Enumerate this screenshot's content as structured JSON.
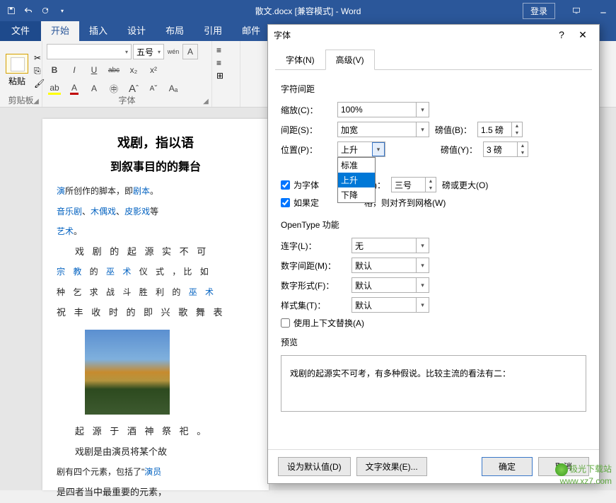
{
  "titlebar": {
    "title": "散文.docx [兼容模式] - Word",
    "login": "登录"
  },
  "menu": {
    "file": "文件",
    "home": "开始",
    "insert": "插入",
    "design": "设计",
    "layout": "布局",
    "ref": "引用",
    "mail": "邮件"
  },
  "ribbon": {
    "paste": "粘贴",
    "clipboard_label": "剪贴板",
    "font_label": "字体",
    "font_size": "五号",
    "wen": "wén",
    "A_box": "A",
    "B": "B",
    "I": "I",
    "U": "U",
    "abc": "abc",
    "x2": "x₂",
    "X2": "x²",
    "A_hl": "A",
    "Aa": "A",
    "A_big": "A",
    "A_small": "A",
    "A_clear": "Aₐ"
  },
  "doc": {
    "h1": "戏剧，指以语",
    "h2": "到叙事目的的舞台",
    "p1a": "演",
    "p1b": "所创作的脚本，即",
    "p1c": "剧本",
    "p1d": "。",
    "p2a": "音乐剧",
    "p2b": "、",
    "p2c": "木偶戏",
    "p2d": "、",
    "p2e": "皮影戏",
    "p2f": "等",
    "p3a": "艺术",
    "p3b": "。",
    "p4": "戏 剧 的 起 源 实 不 可",
    "p5a": "宗 教",
    "p5b": " 的 ",
    "p5c": "巫 术",
    "p5d": " 仪 式 ，比 如",
    "p6a": "种 乞 求 战 斗 胜 利 的 ",
    "p6b": "巫 术",
    "p7": "祝 丰 收 时 的 即 兴 歌 舞 表",
    "p8": "起 源 于 酒 神 祭 祀 。",
    "p9": "戏剧是由演员将某个故",
    "p10a": "剧有四个元素，包括了\"",
    "p10b": "演员",
    "p11": "是四者当中最重要的元素，"
  },
  "dialog": {
    "title": "字体",
    "tab_font": "字体(N)",
    "tab_adv": "高级(V)",
    "section_spacing": "字符间距",
    "scale": "缩放(C)：",
    "scale_val": "100%",
    "spacing": "间距(S)：",
    "spacing_val": "加宽",
    "points1": "磅值(B)：",
    "points1_val": "1.5 磅",
    "position": "位置(P)：",
    "position_val": "上升",
    "points2": "磅值(Y)：",
    "points2_val": "3 磅",
    "opt_std": "标准",
    "opt_up": "上升",
    "opt_down": "下降",
    "kern": "为字体",
    "kern_k": "(K)：",
    "kern_val": "三号",
    "kern_suffix": "磅或更大(O)",
    "grid": "如果定",
    "grid_suffix": "格，则对齐到网格(W)",
    "section_ot": "OpenType 功能",
    "ligature": "连字(L)：",
    "ligature_val": "无",
    "num_spacing": "数字间距(M)：",
    "num_spacing_val": "默认",
    "num_form": "数字形式(F)：",
    "num_form_val": "默认",
    "style_set": "样式集(T)：",
    "style_set_val": "默认",
    "context": "使用上下文替换(A)",
    "preview_label": "预览",
    "preview_text": "戏剧的起源实不可考，有多种假说。比较主流的看法有二：",
    "btn_default": "设为默认值(D)",
    "btn_text_effect": "文字效果(E)...",
    "btn_ok": "确定",
    "btn_cancel": "取消"
  },
  "watermark": {
    "line1": "极光下载站",
    "line2": "www.xz7.com"
  }
}
